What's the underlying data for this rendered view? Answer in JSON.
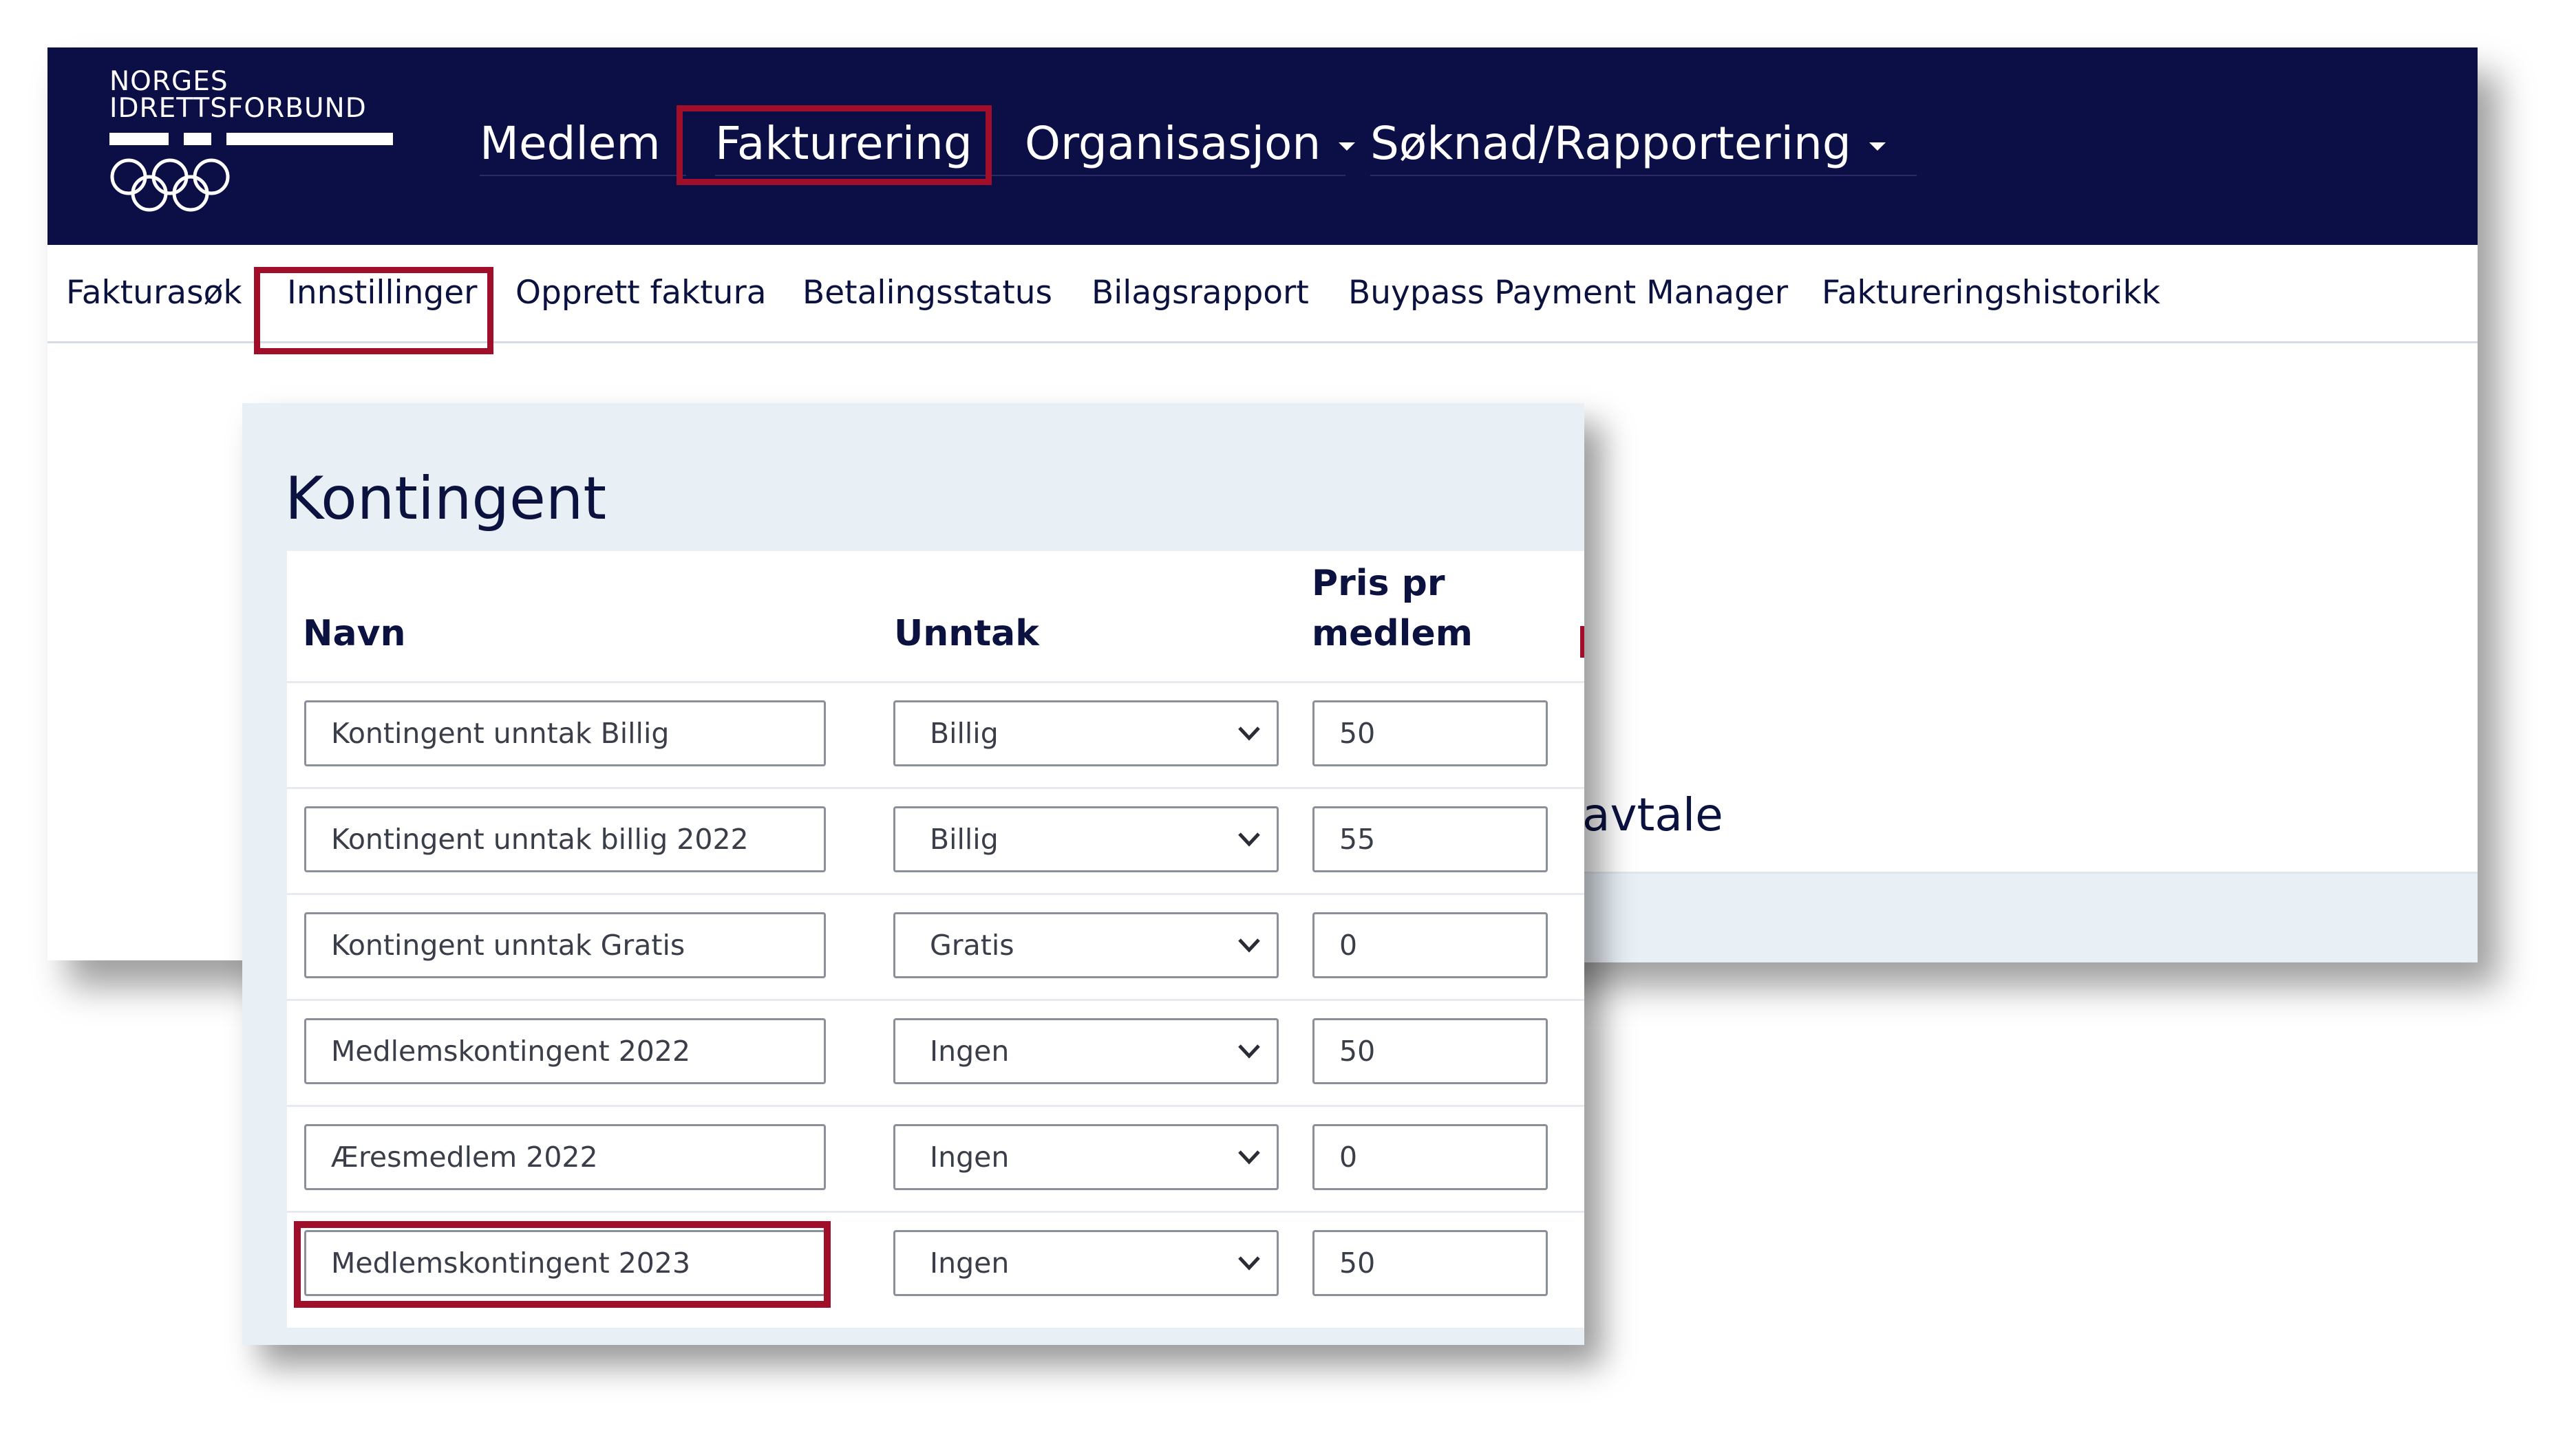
{
  "logo": {
    "line1": "NORGES",
    "line2": "IDRETTSFORBUND"
  },
  "main_nav": [
    {
      "label": "Medlem",
      "dropdown": false
    },
    {
      "label": "Fakturering",
      "dropdown": false,
      "highlighted": true
    },
    {
      "label": "Organisasjon",
      "dropdown": true
    },
    {
      "label": "Søknad/Rapportering",
      "dropdown": true
    }
  ],
  "sub_nav": [
    {
      "label": "Fakturasøk"
    },
    {
      "label": "Innstillinger",
      "highlighted": true
    },
    {
      "label": "Opprett faktura"
    },
    {
      "label": "Betalingsstatus"
    },
    {
      "label": "Bilagsrapport"
    },
    {
      "label": "Buypass Payment Manager"
    },
    {
      "label": "Faktureringshistorikk"
    }
  ],
  "background_fragment": "avtale",
  "panel": {
    "title": "Kontingent",
    "columns": {
      "navn": "Navn",
      "unntak": "Unntak",
      "pris_line1": "Pris pr",
      "pris_line2": "medlem"
    },
    "rows": [
      {
        "navn": "Kontingent unntak Billig",
        "unntak": "Billig",
        "pris": "50"
      },
      {
        "navn": "Kontingent unntak billig 2022",
        "unntak": "Billig",
        "pris": "55"
      },
      {
        "navn": "Kontingent unntak Gratis",
        "unntak": "Gratis",
        "pris": "0"
      },
      {
        "navn": "Medlemskontingent 2022",
        "unntak": "Ingen",
        "pris": "50"
      },
      {
        "navn": "Æresmedlem 2022",
        "unntak": "Ingen",
        "pris": "0"
      },
      {
        "navn": "Medlemskontingent 2023",
        "unntak": "Ingen",
        "pris": "50",
        "highlighted": true
      }
    ]
  },
  "colors": {
    "topbar": "#0b0f45",
    "highlight": "#a10e2a",
    "text": "#0b1240",
    "panel_bg": "#e8f0f6"
  },
  "icons": {
    "dropdown": "caret-down-icon",
    "select": "chevron-down-icon",
    "logo": "olympic-rings-icon"
  }
}
